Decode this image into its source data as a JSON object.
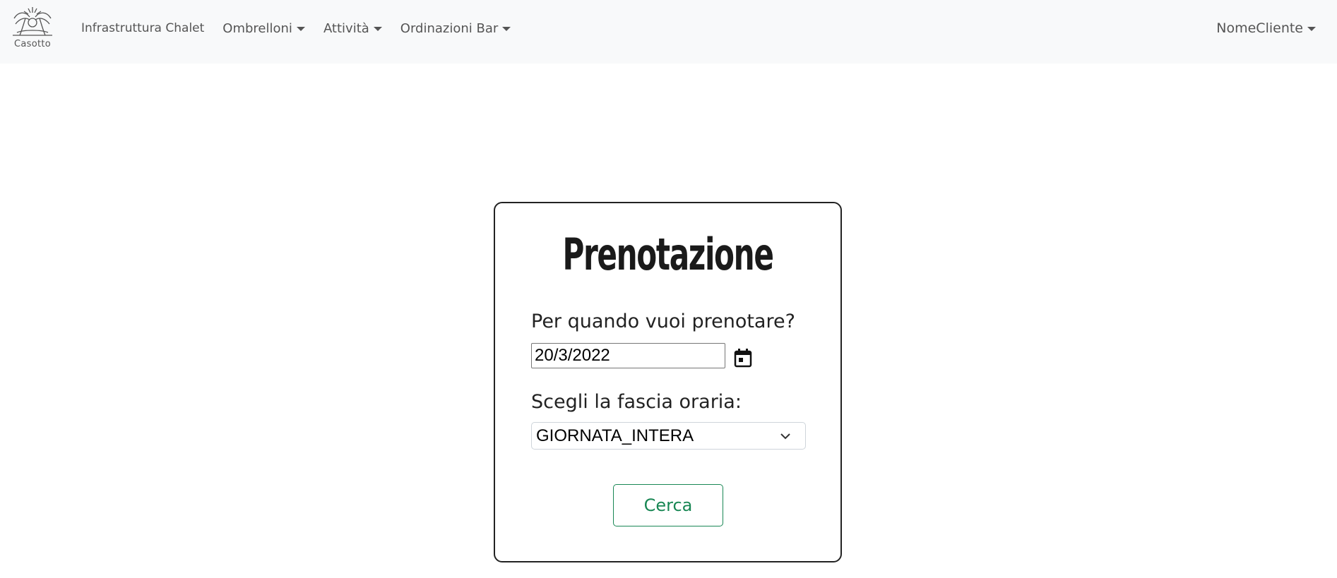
{
  "brand": {
    "name": "Casotto",
    "icon": "palm-tree-logo-icon"
  },
  "nav": {
    "items": [
      {
        "label": "Infrastruttura Chalet",
        "dropdown": false
      },
      {
        "label": "Ombrelloni",
        "dropdown": true
      },
      {
        "label": "Attività",
        "dropdown": true
      },
      {
        "label": "Ordinazioni Bar",
        "dropdown": true
      }
    ],
    "user": {
      "label": "NomeCliente",
      "dropdown": true
    }
  },
  "form": {
    "title": "Prenotazione",
    "date_label": "Per quando vuoi prenotare?",
    "date_value": "20/3/2022",
    "date_icon": "calendar-icon",
    "slot_label": "Scegli la fascia oraria:",
    "slot_value": "GIORNATA_INTERA",
    "submit_label": "Cerca"
  },
  "colors": {
    "accent": "#198754",
    "navbar_bg": "#f8f9fa"
  }
}
